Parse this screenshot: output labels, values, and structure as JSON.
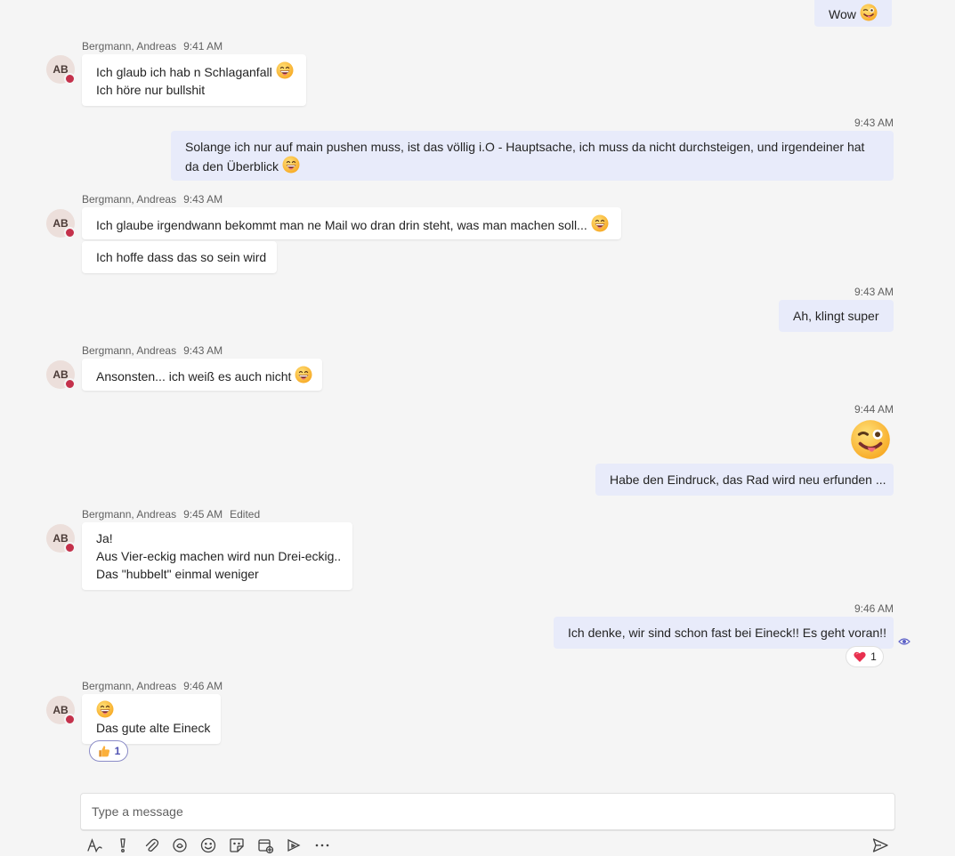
{
  "sender": {
    "name": "Bergmann, Andreas",
    "initials": "AB"
  },
  "messages": {
    "m1": {
      "text": "Wow"
    },
    "m2": {
      "time": "9:41 AM",
      "line1": "Ich glaub ich hab n Schlaganfall",
      "line2": "Ich höre nur bullshit"
    },
    "m3": {
      "time": "9:43 AM",
      "text": "Solange ich nur auf main pushen muss, ist das völlig i.O - Hauptsache, ich muss da nicht durchsteigen, und irgendeiner hat da den Überblick"
    },
    "m4": {
      "time": "9:43 AM",
      "text1": "Ich glaube irgendwann bekommt man ne Mail wo dran drin steht, was man machen soll...",
      "text2": "Ich hoffe dass das so sein wird"
    },
    "m5": {
      "time": "9:43 AM",
      "text": "Ah, klingt super"
    },
    "m6": {
      "time": "9:43 AM",
      "text": "Ansonsten... ich weiß es auch nicht"
    },
    "m7": {
      "time": "9:44 AM",
      "text": "Habe den Eindruck, das Rad wird neu erfunden ..."
    },
    "m8": {
      "time": "9:45 AM",
      "edited": "Edited",
      "line1": "Ja!",
      "line2": "Aus Vier-eckig machen wird nun Drei-eckig..",
      "line3": "Das \"hubbelt\" einmal weniger"
    },
    "m9": {
      "time": "9:46 AM",
      "text": "Ich denke, wir sind schon fast bei Eineck!! Es geht voran!!",
      "reaction_count": "1"
    },
    "m10": {
      "time": "9:46 AM",
      "text": "Das gute alte Eineck",
      "reaction_count": "1"
    }
  },
  "compose": {
    "placeholder": "Type a message"
  },
  "icons": {
    "emoji": "grinning-face-icon",
    "wink": "winking-face-tongue-icon",
    "heart": "heart-icon",
    "thumbs": "thumbs-up-icon",
    "seen": "seen-eye-icon"
  },
  "colors": {
    "outgoing_bubble": "#e8ebfa",
    "incoming_bubble": "#ffffff",
    "accent": "#5b5fc7",
    "status_busy": "#c4314b"
  }
}
